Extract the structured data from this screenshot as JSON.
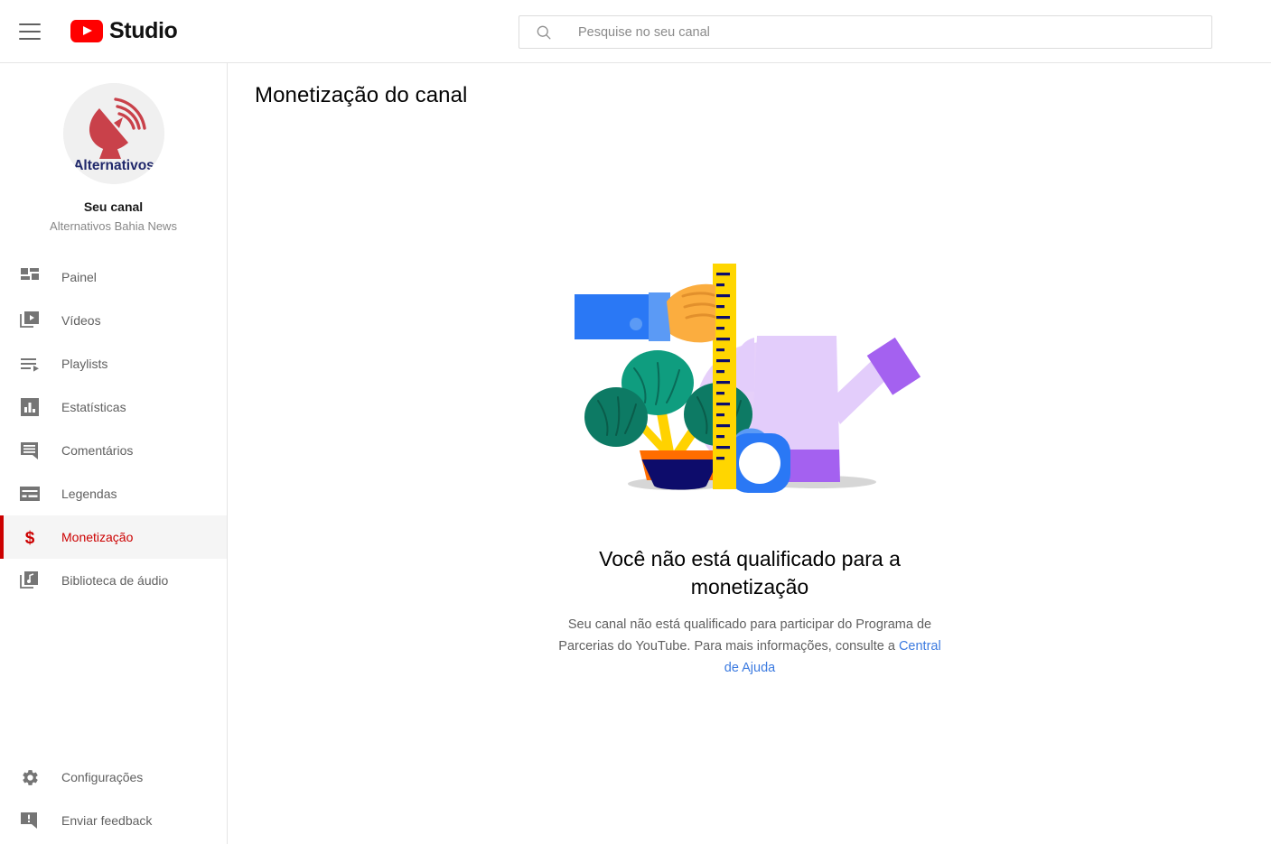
{
  "header": {
    "menu_icon": "hamburger-icon",
    "logo_icon": "youtube-play-icon",
    "brand": "Studio",
    "search": {
      "icon": "search-icon",
      "placeholder": "Pesquise no seu canal",
      "value": ""
    }
  },
  "sidebar": {
    "avatar": {
      "icon": "satellite-dish-icon",
      "logo_text": "Alternativos",
      "logo_color": "#c9414a",
      "logo_text_color": "#20286b",
      "background": "#f0f0f0"
    },
    "channel_label": "Seu canal",
    "channel_name": "Alternativos Bahia News",
    "items": [
      {
        "label": "Painel",
        "icon": "dashboard-icon",
        "active": false
      },
      {
        "label": "Vídeos",
        "icon": "video-stack-icon",
        "active": false
      },
      {
        "label": "Playlists",
        "icon": "playlist-icon",
        "active": false
      },
      {
        "label": "Estatísticas",
        "icon": "bar-chart-icon",
        "active": false
      },
      {
        "label": "Comentários",
        "icon": "comment-icon",
        "active": false
      },
      {
        "label": "Legendas",
        "icon": "subtitles-icon",
        "active": false
      },
      {
        "label": "Monetização",
        "icon": "dollar-sign-icon",
        "active": true
      },
      {
        "label": "Biblioteca de áudio",
        "icon": "music-note-icon",
        "active": false
      }
    ],
    "bottom_items": [
      {
        "label": "Configurações",
        "icon": "gear-icon"
      },
      {
        "label": "Enviar feedback",
        "icon": "feedback-icon"
      }
    ],
    "active_color": "#cc0000",
    "active_background": "#f5f5f5"
  },
  "main": {
    "page_title": "Monetização do canal",
    "empty_state": {
      "illustration_icon": "measuring-plant-illustration",
      "title": "Você não está qualificado para a monetização",
      "body_line_1": "Seu canal não está qualificado para participar do Programa de",
      "body_line_2": "Parcerias do YouTube. Para mais informações, consulte a",
      "link_label": "Central de Ajuda",
      "link_color": "#3b7ae0"
    }
  }
}
